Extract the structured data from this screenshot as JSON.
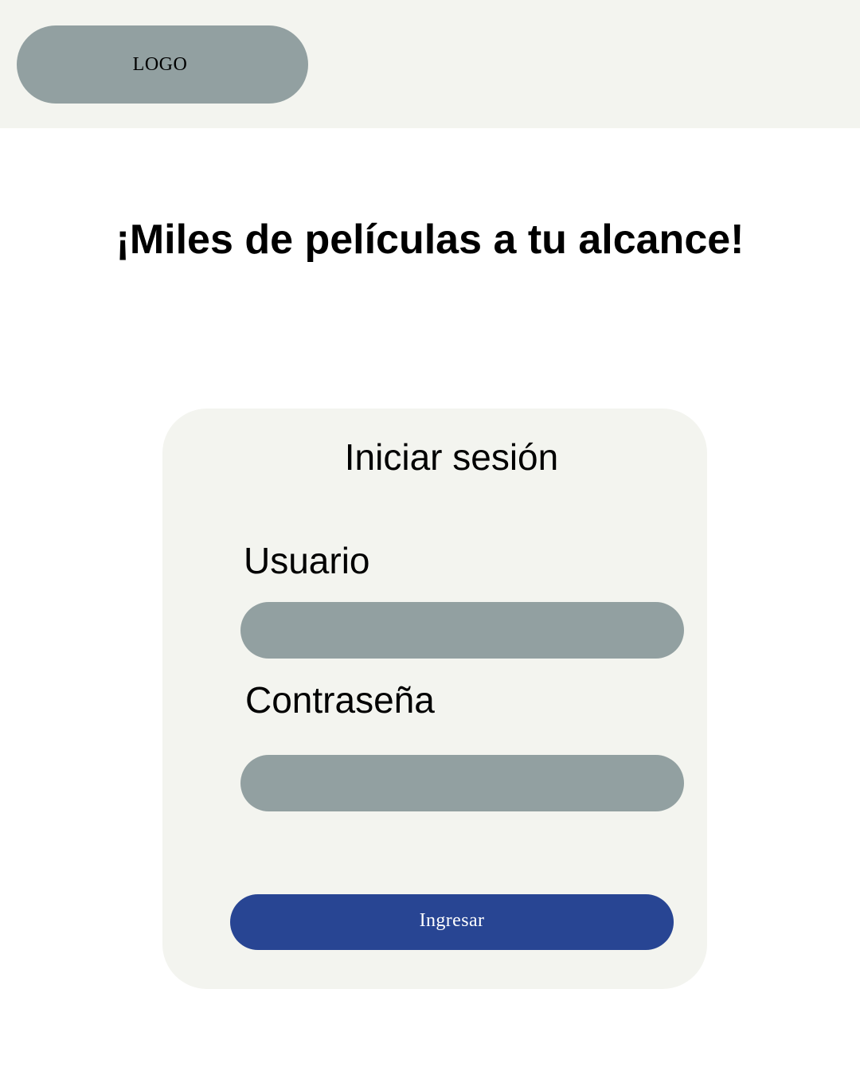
{
  "header": {
    "logo_text": "LOGO"
  },
  "hero": {
    "title": "¡Miles de películas a tu alcance!"
  },
  "login": {
    "title": "Iniciar sesión",
    "username_label": "Usuario",
    "username_value": "",
    "password_label": "Contraseña",
    "password_value": "",
    "submit_label": "Ingresar"
  },
  "colors": {
    "header_background": "#f3f4ef",
    "card_background": "#f3f4ef",
    "field_gray": "#92a0a1",
    "button_blue": "#284593"
  }
}
